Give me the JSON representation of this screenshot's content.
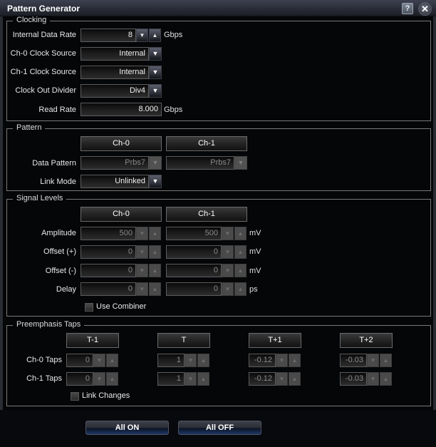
{
  "window": {
    "title": "Pattern Generator",
    "help_icon": "?",
    "close_icon": "✕"
  },
  "clocking": {
    "label": "Clocking",
    "internal_data_rate": {
      "label": "Internal Data Rate",
      "value": "8",
      "unit": "Gbps"
    },
    "ch0_clock_source": {
      "label": "Ch-0 Clock Source",
      "value": "Internal"
    },
    "ch1_clock_source": {
      "label": "Ch-1 Clock Source",
      "value": "Internal"
    },
    "clock_out_divider": {
      "label": "Clock Out Divider",
      "value": "Div4"
    },
    "read_rate": {
      "label": "Read Rate",
      "value": "8.000",
      "unit": "Gbps"
    }
  },
  "pattern": {
    "label": "Pattern",
    "channels": [
      "Ch-0",
      "Ch-1"
    ],
    "data_pattern": {
      "label": "Data Pattern",
      "values": [
        "Prbs7",
        "Prbs7"
      ]
    },
    "link_mode": {
      "label": "Link Mode",
      "value": "Unlinked"
    }
  },
  "signal_levels": {
    "label": "Signal Levels",
    "channels": [
      "Ch-0",
      "Ch-1"
    ],
    "rows": [
      {
        "label": "Amplitude",
        "values": [
          "500",
          "500"
        ],
        "unit": "mV"
      },
      {
        "label": "Offset (+)",
        "values": [
          "0",
          "0"
        ],
        "unit": "mV"
      },
      {
        "label": "Offset (-)",
        "values": [
          "0",
          "0"
        ],
        "unit": "mV"
      },
      {
        "label": "Delay",
        "values": [
          "0",
          "0"
        ],
        "unit": "ps"
      }
    ],
    "use_combiner": {
      "label": "Use Combiner",
      "checked": false
    }
  },
  "preemphasis": {
    "label": "Preemphasis Taps",
    "taps": [
      "T-1",
      "T",
      "T+1",
      "T+2"
    ],
    "rows": [
      {
        "label": "Ch-0 Taps",
        "values": [
          "0",
          "1",
          "-0.12",
          "-0.03"
        ]
      },
      {
        "label": "Ch-1 Taps",
        "values": [
          "0",
          "1",
          "-0.12",
          "-0.03"
        ]
      }
    ],
    "link_changes": {
      "label": "Link Changes",
      "checked": false
    }
  },
  "actions": {
    "all_on": "All ON",
    "all_off": "All OFF"
  },
  "icons": {
    "down": "▼",
    "up": "▲"
  }
}
